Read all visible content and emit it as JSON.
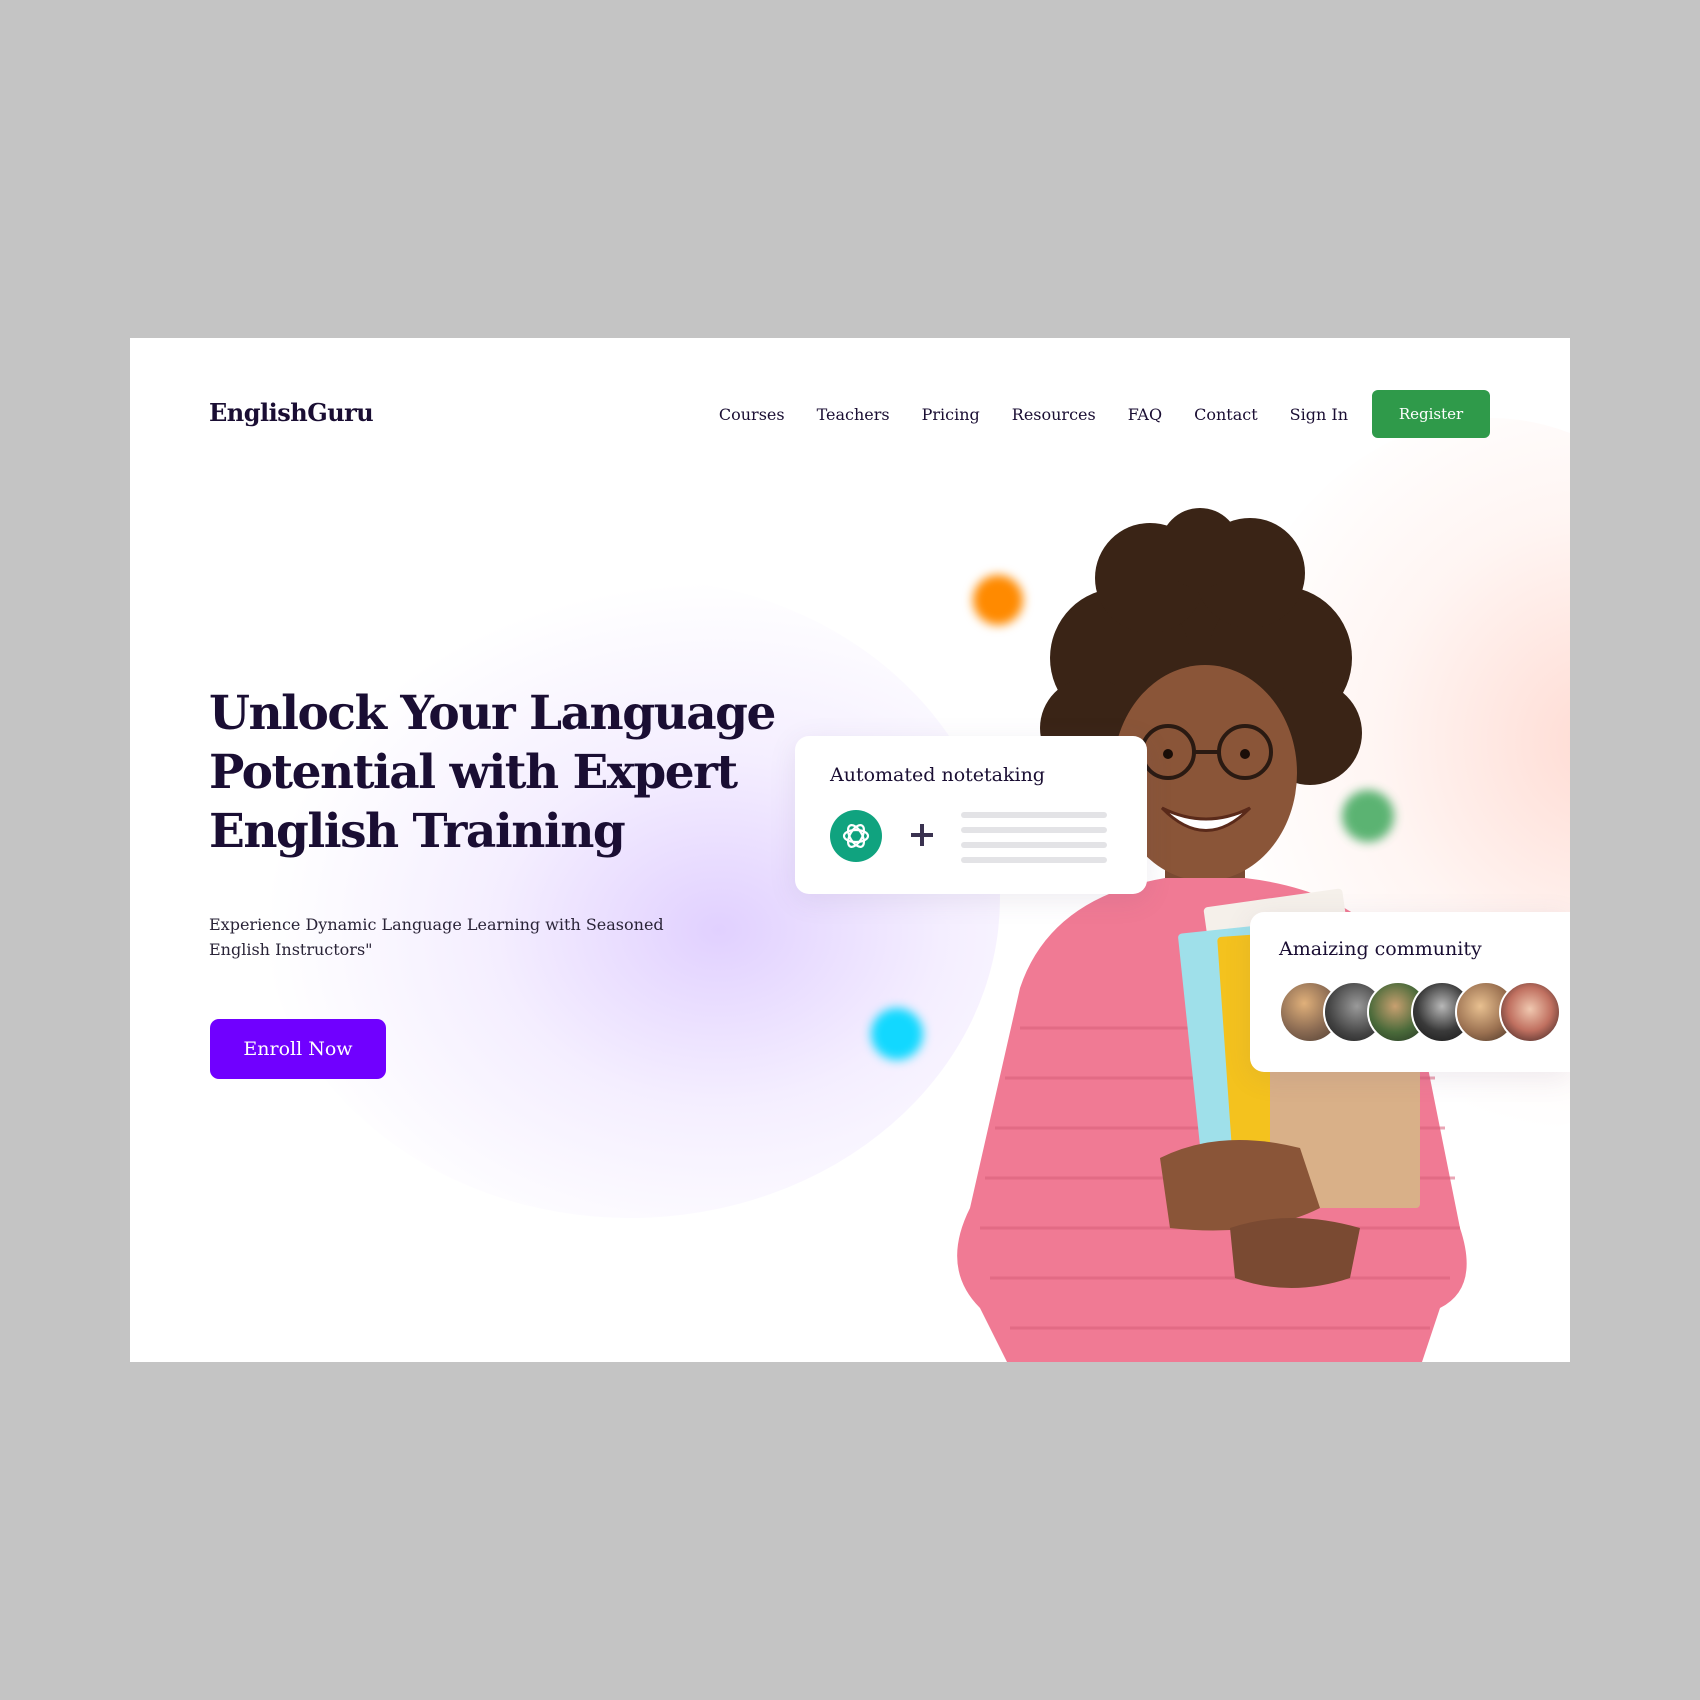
{
  "brand": {
    "logo": "EnglishGuru"
  },
  "nav": {
    "items": [
      {
        "label": "Courses"
      },
      {
        "label": "Teachers"
      },
      {
        "label": "Pricing"
      },
      {
        "label": "Resources"
      },
      {
        "label": "FAQ"
      },
      {
        "label": "Contact"
      },
      {
        "label": "Sign In"
      }
    ],
    "register_label": "Register"
  },
  "hero": {
    "title": "Unlock Your Language Potential with Expert English Training",
    "subtitle": "Experience Dynamic Language Learning with Seasoned English Instructors\"",
    "cta_label": "Enroll Now"
  },
  "cards": {
    "notetaking": {
      "title": "Automated notetaking",
      "icons": [
        "chatgpt-icon",
        "plus-icon"
      ]
    },
    "community": {
      "title": "Amaizing community",
      "avatar_count": 6
    }
  },
  "colors": {
    "brand_dark": "#1a0e33",
    "register_green": "#2f9a4a",
    "cta_purple": "#7000ff",
    "gpt_green": "#10a37f",
    "dot_orange": "#ff8a00",
    "dot_green": "#3fa85c",
    "dot_cyan": "#12d8ff",
    "sweater_pink": "#f07a94",
    "backdrop_gray": "#c4c4c4"
  }
}
